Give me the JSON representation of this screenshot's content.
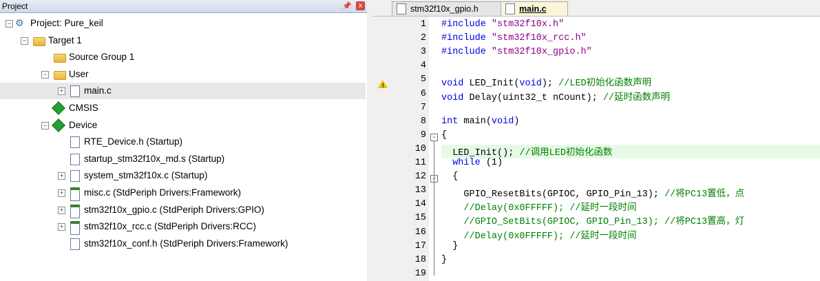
{
  "project_pane": {
    "title": "Project",
    "pin": "ᵖ",
    "close": "x",
    "tree": [
      {
        "label": "Project: Pure_keil",
        "icon": "project-icon",
        "expander": "−",
        "level": 0
      },
      {
        "label": "Target 1",
        "icon": "target-icon",
        "expander": "−",
        "level": 1
      },
      {
        "label": "Source Group 1",
        "icon": "folder-icon",
        "level": 2
      },
      {
        "label": "User",
        "icon": "folder-icon",
        "expander": "−",
        "level": 2
      },
      {
        "label": "main.c",
        "icon": "file-icon",
        "expander": "+",
        "level": 3,
        "selected": true
      },
      {
        "label": "CMSIS",
        "icon": "green-diamond-icon",
        "level": 2
      },
      {
        "label": "Device",
        "icon": "green-diamond-icon",
        "expander": "−",
        "level": 2
      },
      {
        "label": "RTE_Device.h (Startup)",
        "icon": "file-icon",
        "level": 3
      },
      {
        "label": "startup_stm32f10x_md.s (Startup)",
        "icon": "file-icon",
        "level": 3
      },
      {
        "label": "system_stm32f10x.c (Startup)",
        "icon": "file-icon",
        "expander": "+",
        "level": 3
      },
      {
        "label": "misc.c (StdPeriph Drivers:Framework)",
        "icon": "config-file-icon",
        "expander": "+",
        "level": 3
      },
      {
        "label": "stm32f10x_gpio.c (StdPeriph Drivers:GPIO)",
        "icon": "config-file-icon",
        "expander": "+",
        "level": 3
      },
      {
        "label": "stm32f10x_rcc.c (StdPeriph Drivers:RCC)",
        "icon": "config-file-icon",
        "expander": "+",
        "level": 3
      },
      {
        "label": "stm32f10x_conf.h (StdPeriph Drivers:Framework)",
        "icon": "file-icon",
        "level": 3
      }
    ]
  },
  "tabs": [
    {
      "label": "stm32f10x_gpio.h",
      "active": false
    },
    {
      "label": "main.c",
      "active": true
    }
  ],
  "editor": {
    "lines": [
      {
        "n": "1",
        "parts": [
          [
            "kw",
            "#include "
          ],
          [
            "str",
            "\"stm32f10x.h\""
          ]
        ]
      },
      {
        "n": "2",
        "parts": [
          [
            "kw",
            "#include "
          ],
          [
            "str",
            "\"stm32f10x_rcc.h\""
          ]
        ]
      },
      {
        "n": "3",
        "parts": [
          [
            "kw",
            "#include "
          ],
          [
            "str",
            "\"stm32f10x_gpio.h\""
          ]
        ]
      },
      {
        "n": "4",
        "parts": []
      },
      {
        "n": "5",
        "parts": [
          [
            "kw",
            "void"
          ],
          [
            "fn",
            " LED_Init("
          ],
          [
            "kw",
            "void"
          ],
          [
            "fn",
            "); "
          ],
          [
            "cm",
            "//LED初始化函数声明"
          ]
        ]
      },
      {
        "n": "6",
        "parts": [
          [
            "kw",
            "void"
          ],
          [
            "fn",
            " Delay(uint32_t nCount); "
          ],
          [
            "cm",
            "//延时函数声明"
          ]
        ]
      },
      {
        "n": "7",
        "parts": []
      },
      {
        "n": "8",
        "parts": [
          [
            "kw",
            "int"
          ],
          [
            "fn",
            " main("
          ],
          [
            "kw",
            "void"
          ],
          [
            "fn",
            ")"
          ]
        ]
      },
      {
        "n": "9",
        "parts": [
          [
            "fn",
            "{"
          ]
        ]
      },
      {
        "n": "10",
        "parts": [
          [
            "fn",
            "  LED_Init(); "
          ],
          [
            "cm",
            "//调用LED初始化函数"
          ]
        ]
      },
      {
        "n": "11",
        "parts": [
          [
            "kw",
            "  while"
          ],
          [
            "fn",
            " (1)"
          ]
        ]
      },
      {
        "n": "12",
        "parts": [
          [
            "fn",
            "  {"
          ]
        ]
      },
      {
        "n": "13",
        "parts": [
          [
            "fn",
            "    GPIO_ResetBits(GPIOC, GPIO_Pin_13); "
          ],
          [
            "cm",
            "//将PC13置低，点"
          ]
        ]
      },
      {
        "n": "14",
        "parts": [
          [
            "cm",
            "    //Delay(0x0FFFFF); //延时一段时间"
          ]
        ]
      },
      {
        "n": "15",
        "parts": [
          [
            "cm",
            "    //GPIO_SetBits(GPIOC, GPIO_Pin_13); //将PC13置高，灯"
          ]
        ]
      },
      {
        "n": "16",
        "parts": [
          [
            "cm",
            "    //Delay(0x0FFFFF); //延时一段时间"
          ]
        ]
      },
      {
        "n": "17",
        "parts": [
          [
            "fn",
            "  }"
          ]
        ]
      },
      {
        "n": "18",
        "parts": [
          [
            "fn",
            "}"
          ]
        ]
      },
      {
        "n": "19",
        "parts": []
      }
    ],
    "highlighted_line": "10",
    "warning_line": "5"
  }
}
